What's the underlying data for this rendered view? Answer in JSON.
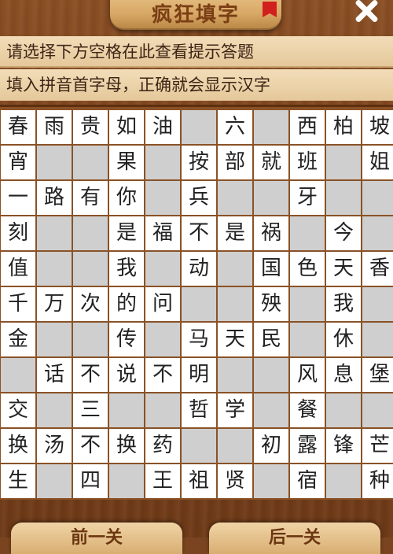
{
  "header": {
    "title": "疯狂填字"
  },
  "hints": {
    "line1": "请选择下方空格在此查看提示答题",
    "line2": "填入拼音首字母，正确就会显示汉字"
  },
  "grid": [
    [
      "春",
      "雨",
      "贵",
      "如",
      "油",
      "",
      "六",
      "",
      "西",
      "柏",
      "坡"
    ],
    [
      "宵",
      "",
      "",
      "果",
      "",
      "按",
      "部",
      "就",
      "班",
      "",
      "姐"
    ],
    [
      "一",
      "路",
      "有",
      "你",
      "",
      "兵",
      "",
      "",
      "牙",
      "",
      ""
    ],
    [
      "刻",
      "",
      "",
      "是",
      "福",
      "不",
      "是",
      "祸",
      "",
      "今",
      ""
    ],
    [
      "值",
      "",
      "",
      "我",
      "",
      "动",
      "",
      "国",
      "色",
      "天",
      "香"
    ],
    [
      "千",
      "万",
      "次",
      "的",
      "问",
      "",
      "",
      "殃",
      "",
      "我",
      ""
    ],
    [
      "金",
      "",
      "",
      "传",
      "",
      "马",
      "天",
      "民",
      "",
      "休",
      ""
    ],
    [
      "",
      "话",
      "不",
      "说",
      "不",
      "明",
      "",
      "",
      "风",
      "息",
      "堡"
    ],
    [
      "交",
      "",
      "三",
      "",
      "",
      "哲",
      "学",
      "",
      "餐",
      "",
      ""
    ],
    [
      "换",
      "汤",
      "不",
      "换",
      "药",
      "",
      "",
      "初",
      "露",
      "锋",
      "芒"
    ],
    [
      "生",
      "",
      "四",
      "",
      "王",
      "祖",
      "贤",
      "",
      "宿",
      "",
      "种"
    ]
  ],
  "footer": {
    "prev_label": "前一关",
    "next_label": "后一关"
  }
}
